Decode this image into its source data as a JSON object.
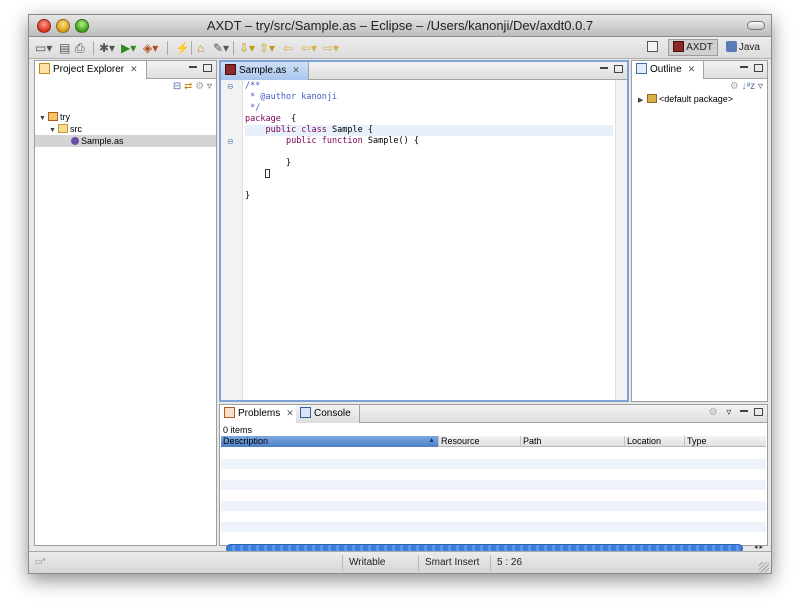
{
  "window": {
    "title": "AXDT – try/src/Sample.as – Eclipse – /Users/kanonji/Dev/axdt0.0.7"
  },
  "toolbar": {
    "items": [
      {
        "name": "new-icon",
        "glyph": "▭▾"
      },
      {
        "name": "save-icon",
        "glyph": "▤"
      },
      {
        "name": "print-icon",
        "glyph": "⎙"
      },
      {
        "name": "debug-icon",
        "glyph": "✱▾"
      },
      {
        "name": "run-icon",
        "glyph": "▶▾"
      },
      {
        "name": "external-tools-icon",
        "glyph": "◈▾"
      },
      {
        "name": "build-icon",
        "glyph": "⚡"
      },
      {
        "name": "open-folder-icon",
        "glyph": "⌂"
      },
      {
        "name": "pen-icon",
        "glyph": "✎▾"
      },
      {
        "name": "next-annotation-icon",
        "glyph": "⇩▾"
      },
      {
        "name": "prev-annotation-icon",
        "glyph": "⇧▾"
      },
      {
        "name": "last-edit-icon",
        "glyph": "⇦"
      },
      {
        "name": "back-icon",
        "glyph": "⇦▾"
      },
      {
        "name": "forward-icon",
        "glyph": "⇨▾"
      }
    ],
    "perspectives": [
      {
        "label": "",
        "icon": "open-perspective-icon",
        "active": false
      },
      {
        "label": "AXDT",
        "icon": "axdt-perspective-icon",
        "active": true
      },
      {
        "label": "Java",
        "icon": "java-perspective-icon",
        "active": false
      }
    ]
  },
  "project_explorer": {
    "tab_label": "Project Explorer",
    "tree": [
      {
        "label": "try",
        "level": 0,
        "icon": "project-icon",
        "expanded": true,
        "selected": false
      },
      {
        "label": "src",
        "level": 1,
        "icon": "folder-icon",
        "expanded": true,
        "selected": false
      },
      {
        "label": "Sample.as",
        "level": 2,
        "icon": "actionscript-file-icon",
        "expanded": null,
        "selected": true
      }
    ]
  },
  "editor": {
    "tab_label": "Sample.as",
    "lines": [
      {
        "fold": "⊖",
        "parts": [
          {
            "t": "/**",
            "c": "comment"
          }
        ]
      },
      {
        "fold": "",
        "parts": [
          {
            "t": " * @author kanonji",
            "c": "comment"
          }
        ]
      },
      {
        "fold": "",
        "parts": [
          {
            "t": " */",
            "c": "comment"
          }
        ]
      },
      {
        "fold": "",
        "parts": [
          {
            "t": "package",
            "c": "kw"
          },
          {
            "t": "  {",
            "c": "def"
          }
        ]
      },
      {
        "fold": "",
        "parts": [
          {
            "t": "    ",
            "c": "def"
          },
          {
            "t": "public class",
            "c": "kw"
          },
          {
            "t": " Sample {",
            "c": "def"
          }
        ],
        "current": true
      },
      {
        "fold": "⊖",
        "parts": [
          {
            "t": "        ",
            "c": "def"
          },
          {
            "t": "public function",
            "c": "kw"
          },
          {
            "t": " Sample() {",
            "c": "def"
          }
        ]
      },
      {
        "fold": "",
        "parts": [
          {
            "t": "",
            "c": "def"
          }
        ]
      },
      {
        "fold": "",
        "parts": [
          {
            "t": "        }",
            "c": "def"
          }
        ]
      },
      {
        "fold": "",
        "parts": [
          {
            "t": "    ",
            "c": "def"
          }
        ],
        "caret": true
      },
      {
        "fold": "",
        "parts": [
          {
            "t": "",
            "c": "def"
          }
        ]
      },
      {
        "fold": "",
        "parts": [
          {
            "t": "}",
            "c": "def"
          }
        ]
      }
    ]
  },
  "outline": {
    "tab_label": "Outline",
    "items": [
      {
        "label": "<default package>",
        "icon": "package-icon"
      }
    ]
  },
  "problems": {
    "tab_label": "Problems",
    "console_tab_label": "Console",
    "count_label": "0 items",
    "columns": [
      {
        "label": "Description",
        "sorted": true
      },
      {
        "label": "Resource",
        "sorted": false
      },
      {
        "label": "Path",
        "sorted": false
      },
      {
        "label": "Location",
        "sorted": false
      },
      {
        "label": "Type",
        "sorted": false
      }
    ]
  },
  "statusbar": {
    "writable": "Writable",
    "insert_mode": "Smart Insert",
    "cursor_position": "5 : 26"
  }
}
